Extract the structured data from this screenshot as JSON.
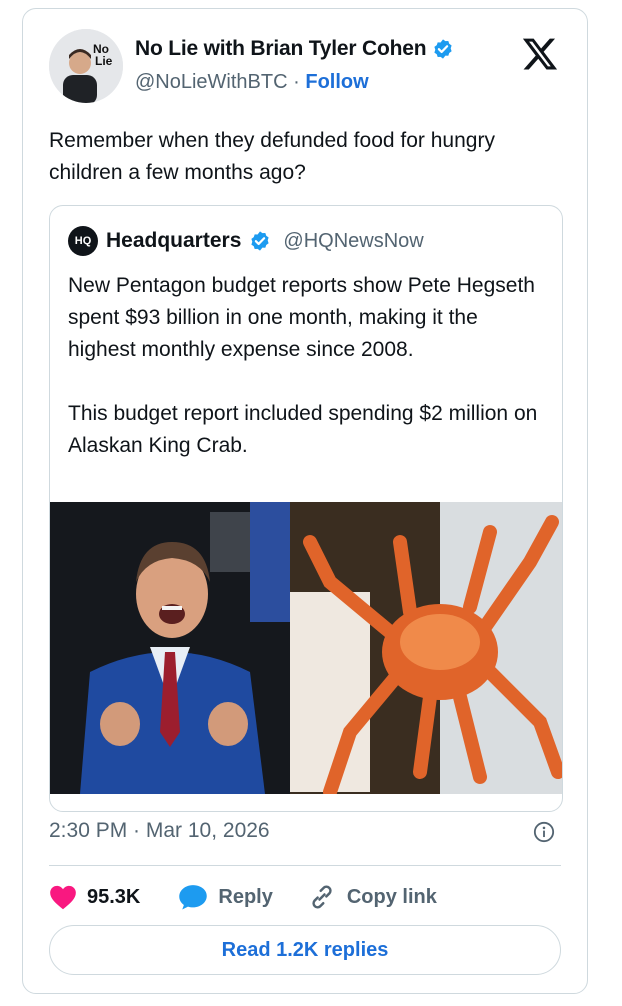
{
  "author": {
    "name": "No Lie with Brian Tyler Cohen",
    "handle": "@NoLieWithBTC",
    "separator": "·",
    "follow_label": "Follow",
    "avatar_text_line1": "No",
    "avatar_text_line2": "Lie"
  },
  "tweet": {
    "text": "Remember when they defunded food for hungry children a few months ago?",
    "timestamp": "2:30 PM · Mar 10, 2026"
  },
  "quoted": {
    "logo_text": "HQ",
    "name": "Headquarters",
    "handle": "@HQNewsNow",
    "paragraph1": "New Pentagon budget reports show Pete Hegseth spent $93 billion in one month, making it the highest monthly expense since 2008.",
    "paragraph2": "This budget report included spending $2 million on Alaskan King Crab."
  },
  "actions": {
    "likes": "95.3K",
    "reply_label": "Reply",
    "copy_label": "Copy link",
    "read_replies": "Read 1.2K replies"
  },
  "colors": {
    "verified": "#1d9bf0",
    "like": "#f91880",
    "link": "#1d6fd8"
  },
  "icons": [
    "verified-badge-icon",
    "x-logo-icon",
    "info-icon",
    "heart-icon",
    "reply-bubble-icon",
    "link-icon"
  ]
}
